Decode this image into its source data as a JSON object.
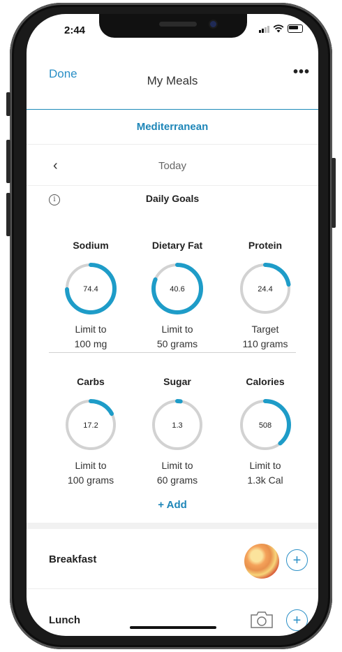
{
  "status_bar": {
    "time": "2:44"
  },
  "header": {
    "done_label": "Done",
    "title": "My Meals",
    "more_label": "•••"
  },
  "tab": {
    "label": "Mediterranean"
  },
  "date_nav": {
    "back_label": "‹",
    "date_label": "Today"
  },
  "goals_section": {
    "info_label": "i",
    "title": "Daily Goals"
  },
  "goals": [
    {
      "name": "Sodium",
      "value": "74.4",
      "line1": "Limit to",
      "line2": "100 mg",
      "progress": 0.744
    },
    {
      "name": "Dietary Fat",
      "value": "40.6",
      "line1": "Limit to",
      "line2": "50 grams",
      "progress": 0.812
    },
    {
      "name": "Protein",
      "value": "24.4",
      "line1": "Target",
      "line2": "110 grams",
      "progress": 0.222
    },
    {
      "name": "Carbs",
      "value": "17.2",
      "line1": "Limit to",
      "line2": "100 grams",
      "progress": 0.172
    },
    {
      "name": "Sugar",
      "value": "1.3",
      "line1": "Limit to",
      "line2": "60 grams",
      "progress": 0.022
    },
    {
      "name": "Calories",
      "value": "508",
      "line1": "Limit to",
      "line2": "1.3k Cal",
      "progress": 0.391
    }
  ],
  "add_label": "+ Add",
  "meals": [
    {
      "name": "Breakfast",
      "add_label": "+"
    },
    {
      "name": "Lunch",
      "add_label": "+"
    }
  ],
  "colors": {
    "accent": "#1e9cc8",
    "track": "#d2d2d2",
    "link": "#2a8fc6"
  },
  "icons": [
    "info-icon",
    "chevron-left-icon",
    "more-icon",
    "camera-icon",
    "plus-icon",
    "signal-icon",
    "wifi-icon",
    "battery-icon"
  ]
}
